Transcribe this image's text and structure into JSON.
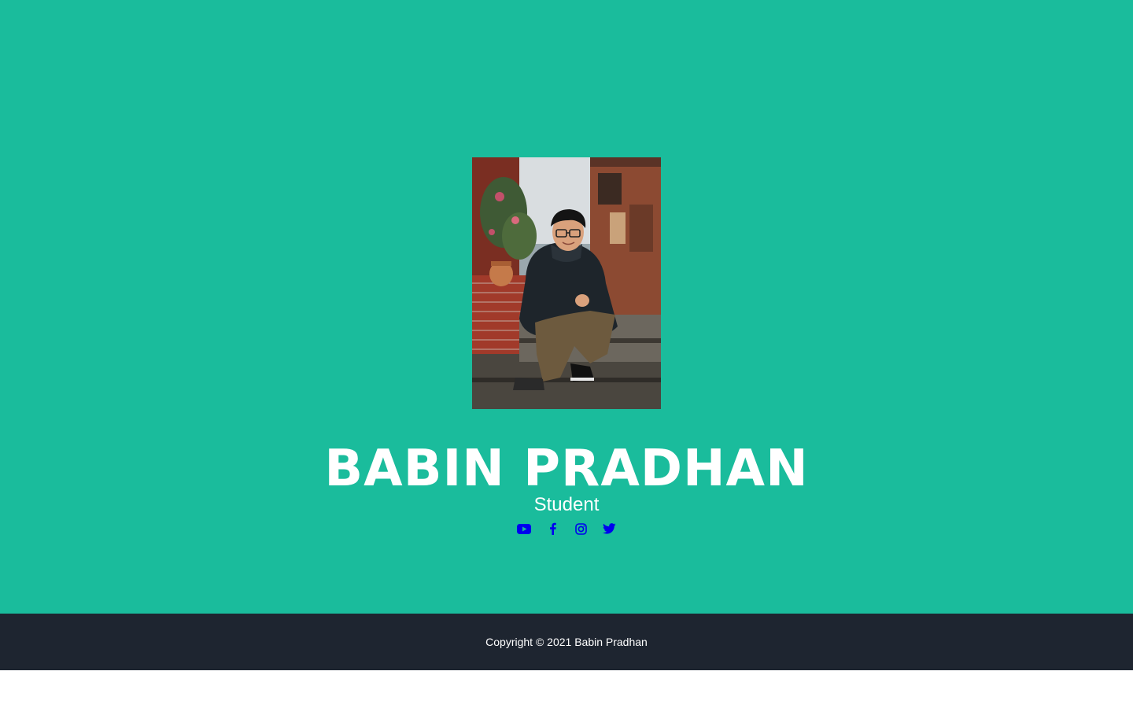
{
  "profile": {
    "name": "BABIN PRADHAN",
    "role": "Student",
    "photo_alt": "profile-photo"
  },
  "social": {
    "items": [
      {
        "icon": "youtube-icon"
      },
      {
        "icon": "facebook-icon"
      },
      {
        "icon": "instagram-icon"
      },
      {
        "icon": "twitter-icon"
      }
    ],
    "icon_color": "#0000ee"
  },
  "footer": {
    "copyright": "Copyright © 2021 Babin Pradhan"
  },
  "colors": {
    "hero_bg": "#1abc9c",
    "footer_bg": "#1e2530",
    "text": "#ffffff"
  }
}
